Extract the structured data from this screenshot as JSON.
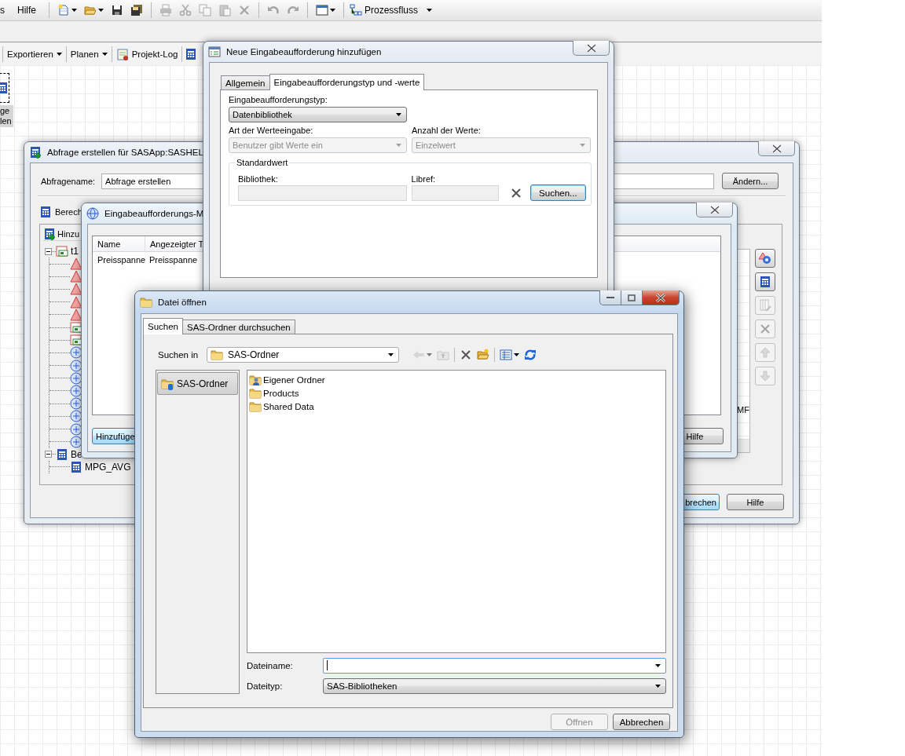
{
  "menu_bar": {
    "items": [
      "s",
      "Hilfe"
    ],
    "icon_groups": [
      [
        {
          "kind": "new",
          "menu": true,
          "disabled": false
        },
        {
          "kind": "open",
          "menu": true,
          "disabled": false
        },
        {
          "kind": "save",
          "menu": false,
          "disabled": false
        },
        {
          "kind": "save_all",
          "menu": false,
          "disabled": false
        }
      ],
      [
        {
          "kind": "print",
          "menu": false,
          "disabled": true
        },
        {
          "kind": "cut",
          "menu": false,
          "disabled": true
        },
        {
          "kind": "copy",
          "menu": false,
          "disabled": true
        },
        {
          "kind": "paste",
          "menu": false,
          "disabled": true
        },
        {
          "kind": "delete",
          "menu": false,
          "disabled": true
        }
      ],
      [
        {
          "kind": "undo",
          "menu": false,
          "disabled": true
        },
        {
          "kind": "redo",
          "menu": false,
          "disabled": true
        }
      ],
      [
        {
          "kind": "window",
          "menu": true,
          "disabled": false
        }
      ]
    ],
    "process_flow": "Prozessfluss"
  },
  "toolbar": {
    "items": [
      {
        "label": "Exportieren",
        "kind": "menu"
      },
      {
        "label": "Planen",
        "kind": "menu"
      },
      {
        "label": "Projekt-Log",
        "kind": "icon"
      }
    ]
  },
  "canvas": {
    "node_label": [
      "ge",
      "len"
    ]
  },
  "query_window": {
    "title": "Abfrage erstellen für SASApp:SASHEL",
    "name_label": "Abfragename:",
    "name_value": "Abfrage erstellen",
    "change_button": "Ändern...",
    "section": "Berech",
    "pane_header": "Hinzu",
    "tree": [
      {
        "label": "t1",
        "expanded": true,
        "children": [
          {
            "kind": "character"
          },
          {
            "kind": "character"
          },
          {
            "kind": "character"
          },
          {
            "kind": "character"
          },
          {
            "kind": "character"
          },
          {
            "kind": "date"
          },
          {
            "kind": "date"
          },
          {
            "kind": "numeric"
          },
          {
            "kind": "numeric"
          },
          {
            "kind": "numeric"
          },
          {
            "kind": "numeric"
          },
          {
            "kind": "numeric"
          },
          {
            "kind": "numeric"
          },
          {
            "kind": "numeric"
          },
          {
            "kind": "numeric"
          }
        ]
      },
      {
        "label": "Be",
        "expanded": true,
        "children": [
          {
            "kind": "computed",
            "label": "MPG_AVG"
          }
        ]
      }
    ],
    "list_text": "MF",
    "side_buttons": [
      {
        "kind": "prompt",
        "disabled": false
      },
      {
        "kind": "calc",
        "disabled": false
      },
      {
        "kind": "edit",
        "disabled": true
      },
      {
        "kind": "x",
        "disabled": true
      },
      {
        "kind": "up_arrow",
        "disabled": true
      },
      {
        "kind": "down_arrow",
        "disabled": true
      }
    ],
    "buttons": [
      {
        "label": "brechen",
        "focused": true
      },
      {
        "label": "Hilfe",
        "focused": false
      }
    ]
  },
  "prompt_manager": {
    "title": "Eingabeaufforderungs-M",
    "columns": [
      "Name",
      "Angezeigter T"
    ],
    "rows": [
      [
        "Preisspanne",
        "Preisspanne"
      ]
    ],
    "buttons": [
      {
        "label": "Hinzufüge",
        "focused": true
      },
      {
        "label": "Hilfe",
        "focused": false
      }
    ]
  },
  "new_prompt": {
    "title": "Neue Eingabeaufforderung hinzufügen",
    "tabs": [
      {
        "label": "Allgemein",
        "selected": false
      },
      {
        "label": "Eingabeaufforderungstyp und -werte",
        "selected": true
      }
    ],
    "type_label": "Eingabeaufforderungstyp:",
    "type_value": "Datenbibliothek",
    "fields": [
      {
        "label": "Art der Werteeingabe:",
        "value": "Benutzer gibt Werte ein",
        "disabled": true
      },
      {
        "label": "Anzahl der Werte:",
        "value": "Einzelwert",
        "disabled": true
      }
    ],
    "default_group": {
      "title": "Standardwert",
      "library_label": "Bibliothek:",
      "libref_label": "Libref:",
      "browse_button": "Suchen..."
    }
  },
  "open_dialog": {
    "title": "Datei öffnen",
    "tabs": [
      {
        "label": "Suchen",
        "selected": true
      },
      {
        "label": "SAS-Ordner durchsuchen",
        "selected": false
      }
    ],
    "look_in_label": "Suchen in",
    "look_in_value": "SAS-Ordner",
    "tool_groups": [
      [
        {
          "kind": "back",
          "menu": true,
          "disabled": true
        },
        {
          "kind": "up",
          "menu": false,
          "disabled": true
        }
      ],
      [
        {
          "kind": "x",
          "menu": false,
          "disabled": false
        },
        {
          "kind": "new_folder",
          "menu": false,
          "disabled": false
        }
      ],
      [
        {
          "kind": "views",
          "menu": true,
          "disabled": false
        },
        {
          "kind": "refresh",
          "menu": false,
          "disabled": false
        }
      ]
    ],
    "places": [
      {
        "label": "SAS-Ordner",
        "selected": true
      }
    ],
    "files": [
      {
        "kind": "user_folder",
        "label": "Eigener Ordner"
      },
      {
        "kind": "folder",
        "label": "Products"
      },
      {
        "kind": "folder",
        "label": "Shared Data"
      }
    ],
    "file_name_label": "Dateiname:",
    "file_type_label": "Dateityp:",
    "file_type_value": "SAS-Bibliotheken",
    "buttons": [
      {
        "label": "Öffnen",
        "disabled": true
      },
      {
        "label": "Abbrechen",
        "disabled": false
      }
    ]
  }
}
